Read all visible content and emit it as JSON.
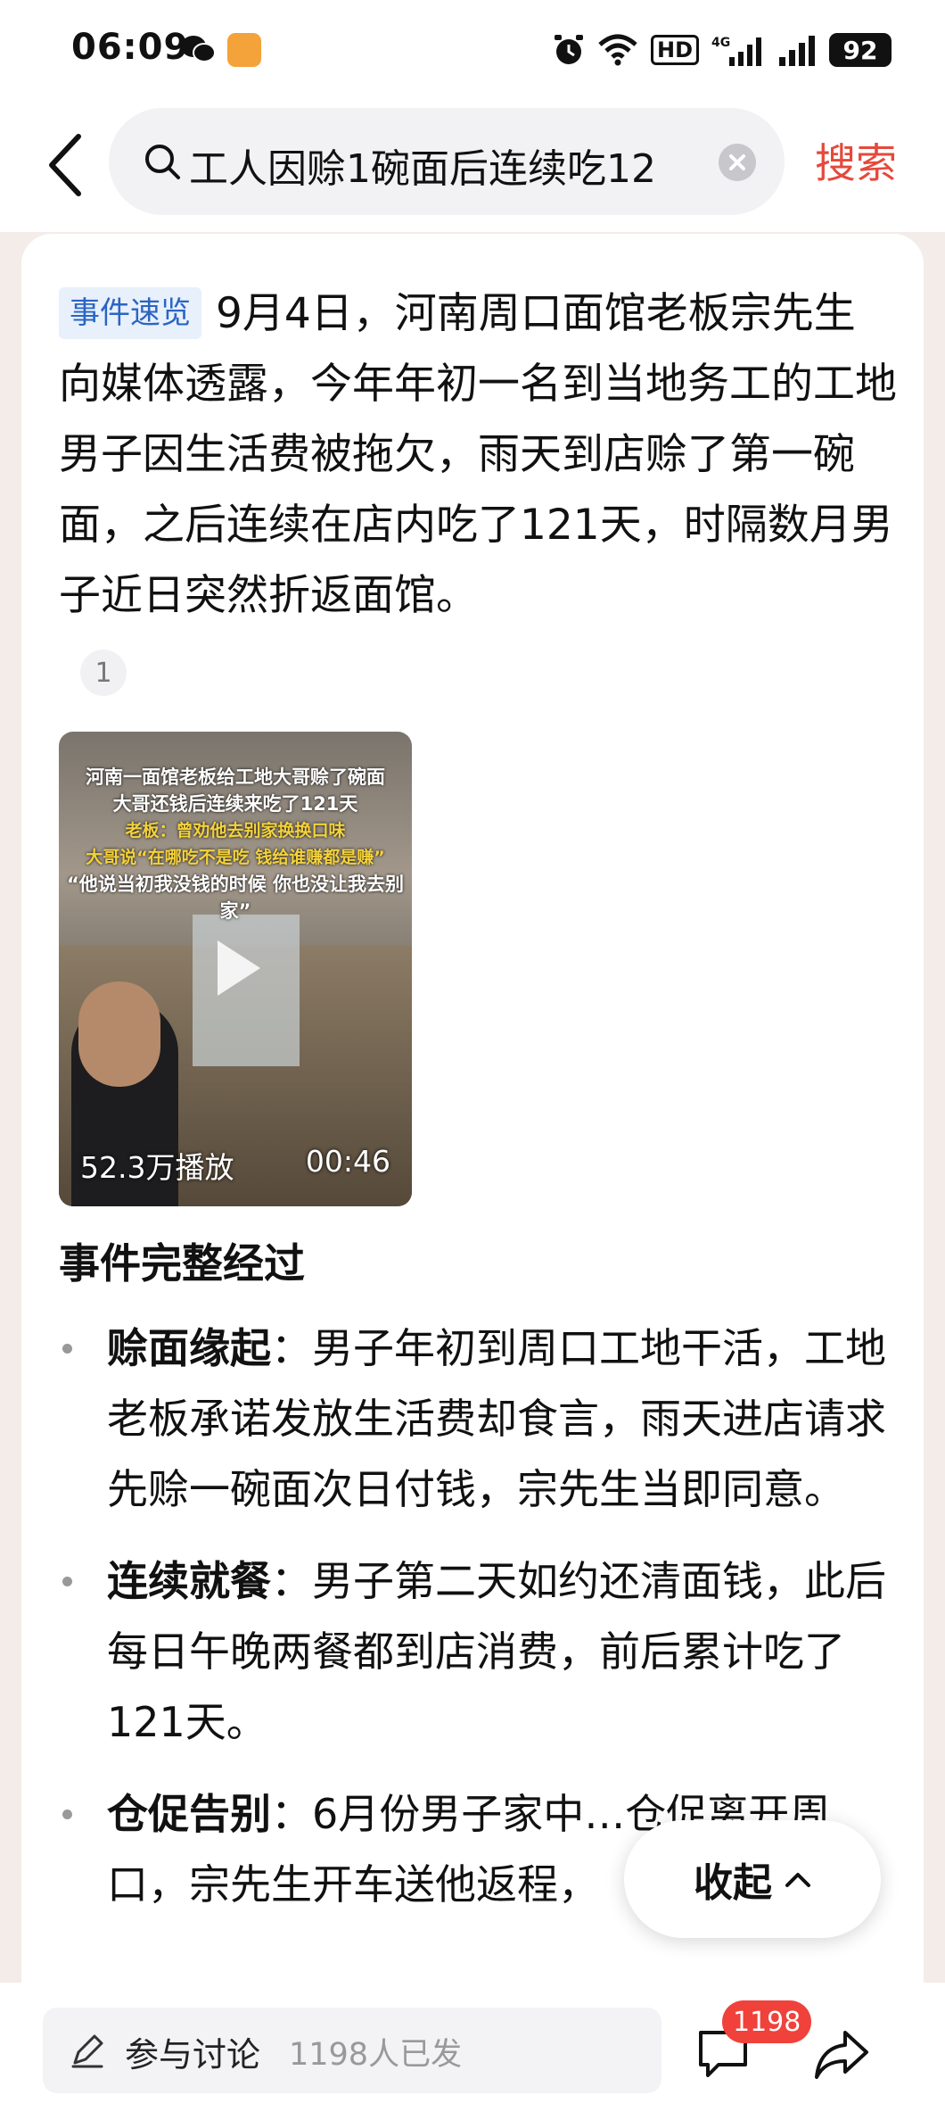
{
  "status_bar": {
    "time": "06:09",
    "network": "HD",
    "signal_label": "4G",
    "battery": "92"
  },
  "header": {
    "search_query": "工人因赊1碗面后连续吃12",
    "search_button": "搜索"
  },
  "summary": {
    "tag": "事件速览",
    "text": "9月4日，河南周口面馆老板宗先生向媒体透露，今年年初一名到当地务工的工地男子因生活费被拖欠，雨天到店赊了第一碗面，之后连续在店内吃了121天，时隔数月男子近日突然折返面馆。",
    "citation": "1"
  },
  "video": {
    "caption_line1": "河南一面馆老板给工地大哥赊了碗面",
    "caption_line2": "大哥还钱后连续来吃了121天",
    "caption_line3": "老板：曾劝他去别家换换口味",
    "caption_line4": "大哥说“在哪吃不是吃 钱给谁赚都是赚”",
    "caption_line5": "“他说当初我没钱的时候 你也没让我去别家”",
    "views": "52.3万播放",
    "duration": "00:46"
  },
  "section_title": "事件完整经过",
  "bullets": [
    {
      "title": "赊面缘起",
      "sep": "：",
      "text": "男子年初到周口工地干活，工地老板承诺发放生活费却食言，雨天进店请求先赊一碗面次日付钱，宗先生当即同意。"
    },
    {
      "title": "连续就餐",
      "sep": "：",
      "text": "男子第二天如约还清面钱，此后每日午晚两餐都到店消费，前后累计吃了121天。"
    },
    {
      "title": "仓促告别",
      "sep": "：",
      "text": "6月份男子家中…仓促离开周口，宗先生开车送他返程，"
    }
  ],
  "collapse_label": "收起",
  "bottom_bar": {
    "discuss_label": "参与讨论",
    "discuss_count": "1198人已发",
    "comment_badge": "1198"
  }
}
